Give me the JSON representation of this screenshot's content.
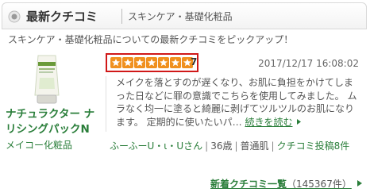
{
  "header": {
    "title": "最新クチコミ",
    "subtitle": "スキンケア・基礎化粧品"
  },
  "intro": "スキンケア・基礎化粧品についての最新クチコミをピックアップ！",
  "product": {
    "name_line1": "ナチュラクター ナ",
    "name_line2": "リシングパックN",
    "maker": "メイコー化粧品"
  },
  "review": {
    "stars": 7,
    "stars_max": 7,
    "score": "7",
    "date": "2017/12/17 16:08:02",
    "text": "メイクを落とすのが遅くなり、お肌に負担をかけてしまった日などに罪の意識でこちらを使用してみました。 ムラなく均一に塗ると綺麗に剥げてツルツルのお肌になります。 定期的に使いたいパ…",
    "read_more": "続きを読む",
    "user": "ふーふーU・ι・Uさん",
    "age": "36歳",
    "skin": "普通肌",
    "posts": "クチコミ投稿8件"
  },
  "footer": {
    "link_label": "新着クチコミ一覧",
    "count": "（145367件）"
  },
  "colors": {
    "accent_green": "#2a7e3a",
    "star_orange": "#f0901e",
    "highlight_red": "#d01818"
  }
}
